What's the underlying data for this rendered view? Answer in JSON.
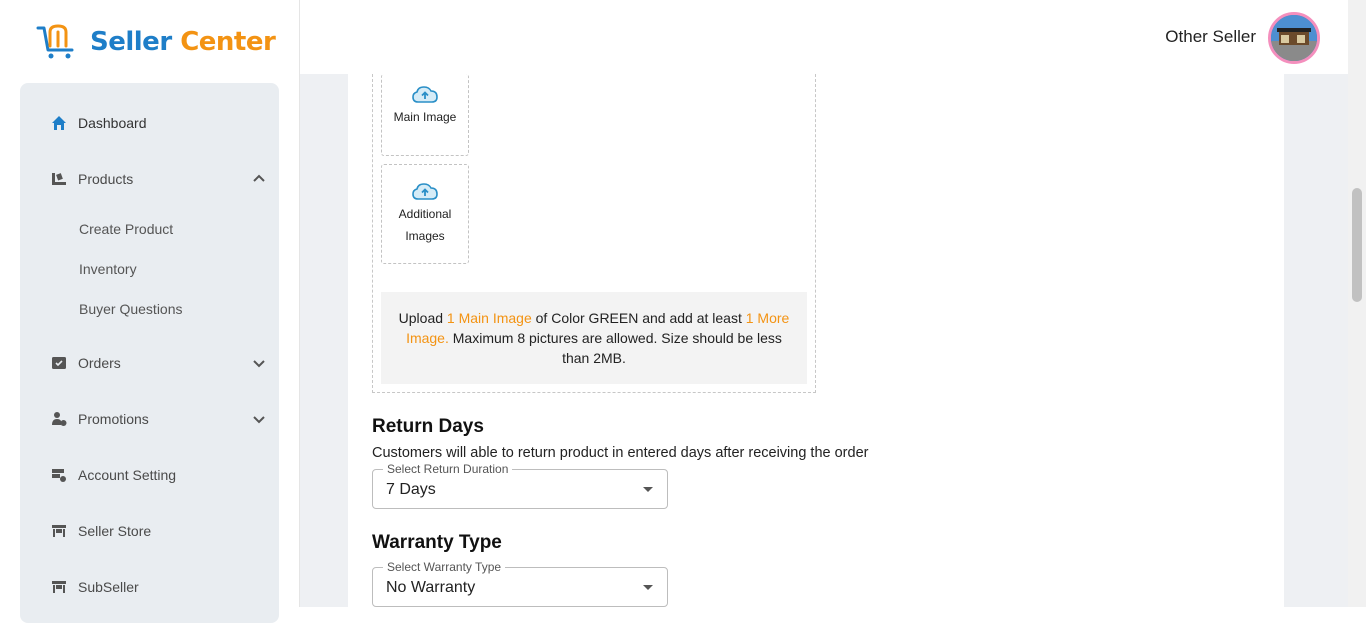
{
  "brand": {
    "seller": "Seller",
    "center": "Center",
    "icon": "cart-logo-icon"
  },
  "header": {
    "user_name": "Other Seller"
  },
  "sidebar": {
    "items": [
      {
        "label": "Dashboard",
        "icon": "home-icon"
      },
      {
        "label": "Products",
        "icon": "products-icon",
        "expanded": true
      },
      {
        "label": "Orders",
        "icon": "orders-icon"
      },
      {
        "label": "Promotions",
        "icon": "promotions-icon"
      },
      {
        "label": "Account Setting",
        "icon": "account-setting-icon"
      },
      {
        "label": "Seller Store",
        "icon": "store-icon"
      },
      {
        "label": "SubSeller",
        "icon": "subseller-icon"
      }
    ],
    "products_sub": [
      "Create Product",
      "Inventory",
      "Buyer Questions"
    ]
  },
  "upload": {
    "main_image_label": "Main Image",
    "additional_label_1": "Additional",
    "additional_label_2": "Images",
    "note": {
      "p1": "Upload ",
      "h1": "1 Main Image",
      "p2": " of Color GREEN and add at least ",
      "h2": "1 More Image.",
      "p3": " Maximum 8 pictures are allowed. Size should be less than 2MB."
    }
  },
  "return_days": {
    "title": "Return Days",
    "description": "Customers will able to return product in entered days after receiving the order",
    "select_label": "Select Return Duration",
    "value": "7 Days"
  },
  "warranty": {
    "title": "Warranty Type",
    "select_label": "Select Warranty Type",
    "value": "No Warranty"
  },
  "colors": {
    "accent_blue": "#1e7ec8",
    "accent_orange": "#f39313",
    "avatar_ring": "#f48fbd"
  }
}
